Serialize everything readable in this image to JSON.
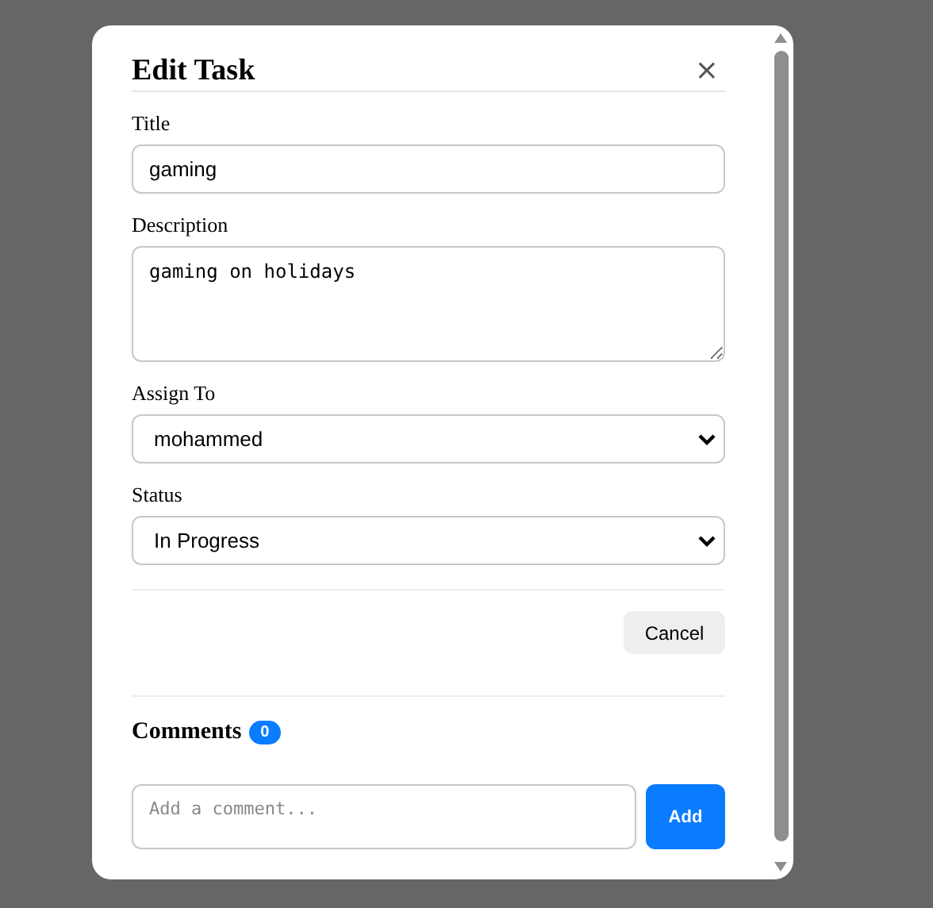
{
  "modal": {
    "title": "Edit Task",
    "close": "×"
  },
  "fields": [
    {
      "kind": "input",
      "label": "Title",
      "value": "gaming"
    },
    {
      "kind": "textarea",
      "label": "Description",
      "value": "gaming on holidays"
    },
    {
      "kind": "select",
      "label": "Assign To",
      "value": "mohammed"
    },
    {
      "kind": "select",
      "label": "Status",
      "value": "In Progress"
    }
  ],
  "buttons": [
    "Cancel"
  ],
  "comments": {
    "heading": "Comments",
    "count": "0",
    "placeholder": "Add a comment...",
    "add_button": "Add"
  }
}
